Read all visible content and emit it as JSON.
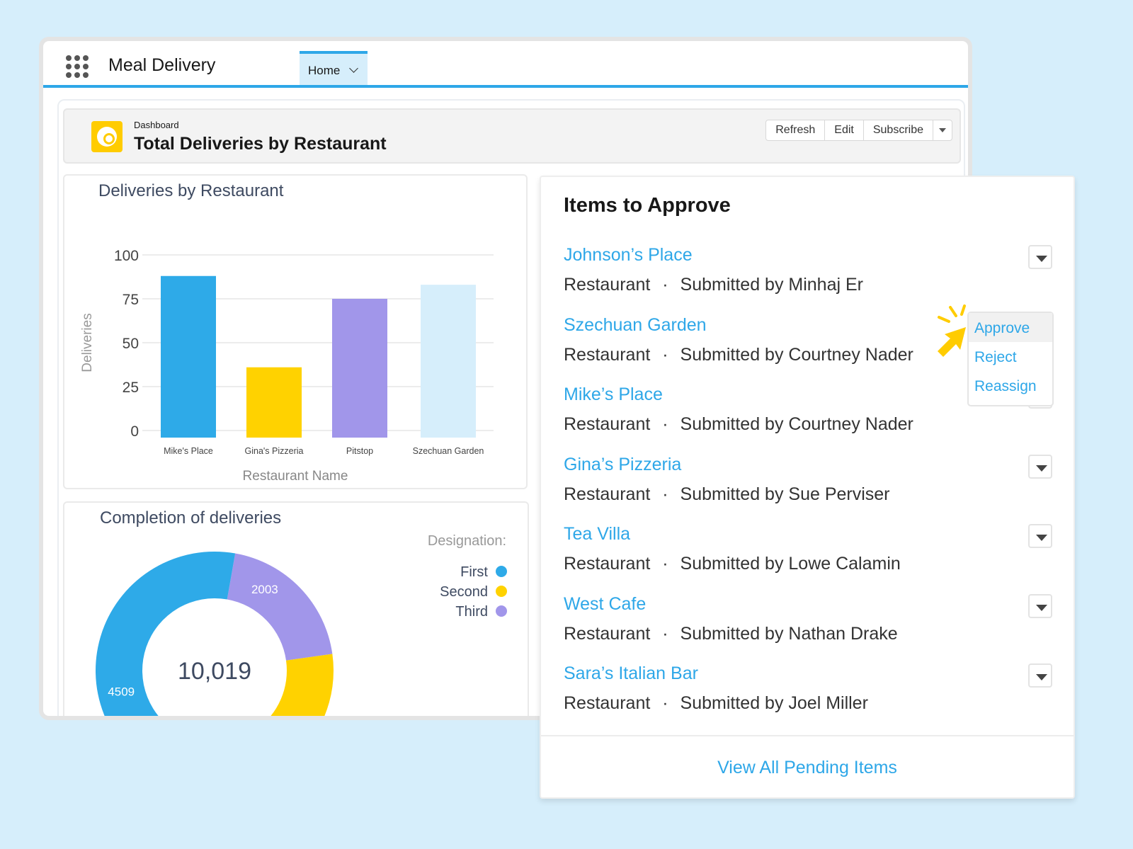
{
  "app": {
    "title": "Meal Delivery",
    "tab": "Home"
  },
  "dashboard": {
    "kicker": "Dashboard",
    "title": "Total Deliveries by Restaurant",
    "buttons": [
      "Refresh",
      "Edit",
      "Subscribe"
    ]
  },
  "chart_data": [
    {
      "type": "bar",
      "title": "Deliveries by Restaurant",
      "xlabel": "Restaurant Name",
      "ylabel": "Deliveries",
      "ylim": [
        0,
        100
      ],
      "yticks": [
        0,
        25,
        50,
        75,
        100
      ],
      "grid": true,
      "categories": [
        "Mike's Place",
        "Gina's Pizzeria",
        "Pitstop",
        "Szechuan Garden"
      ],
      "values": [
        88,
        36,
        75,
        83
      ],
      "colors": [
        "#2eaae8",
        "#ffd200",
        "#a196ea",
        "#d6eefb"
      ]
    },
    {
      "type": "pie",
      "title": "Completion of deliveries",
      "legend_title": "Designation:",
      "legend_position": "top-right",
      "center_label": "10,019",
      "series": [
        {
          "name": "First",
          "value": 4509,
          "label": "4509",
          "color": "#2eaae8"
        },
        {
          "name": "Second",
          "value": 3507,
          "label": "",
          "color": "#ffd200"
        },
        {
          "name": "Third",
          "value": 2003,
          "label": "2003",
          "color": "#a196ea"
        }
      ]
    }
  ],
  "approvals": {
    "title": "Items to Approve",
    "items": [
      {
        "name": "Johnson’s Place",
        "type": "Restaurant",
        "submitter": "Submitted by Minhaj Er"
      },
      {
        "name": "Szechuan Garden",
        "type": "Restaurant",
        "submitter": "Submitted by Courtney Nader"
      },
      {
        "name": "Mike’s Place",
        "type": "Restaurant",
        "submitter": "Submitted by Courtney Nader"
      },
      {
        "name": "Gina’s Pizzeria",
        "type": "Restaurant",
        "submitter": "Submitted by Sue Perviser"
      },
      {
        "name": "Tea Villa",
        "type": "Restaurant",
        "submitter": "Submitted by Lowe Calamin"
      },
      {
        "name": "West Cafe",
        "type": "Restaurant",
        "submitter": "Submitted by Nathan Drake"
      },
      {
        "name": "Sara’s Italian Bar",
        "type": "Restaurant",
        "submitter": "Submitted by Joel Miller"
      }
    ],
    "menu": [
      "Approve",
      "Reject",
      "Reassign"
    ],
    "footer": "View All Pending Items"
  }
}
